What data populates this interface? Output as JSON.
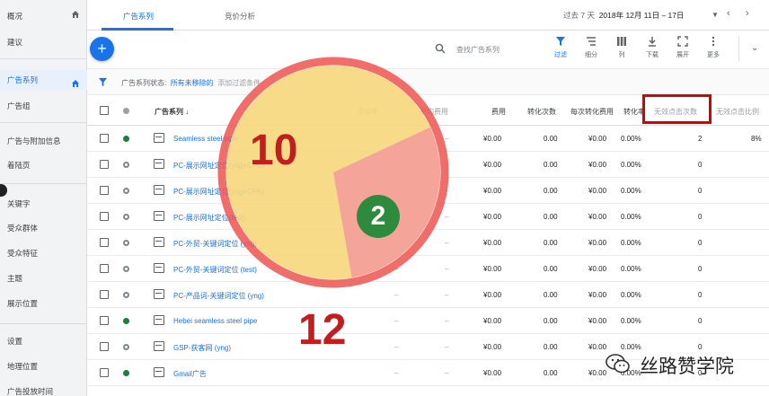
{
  "sidebar": {
    "items": [
      {
        "label": "概况",
        "active": false
      },
      {
        "label": "建议",
        "active": false
      },
      {
        "label": "广告系列",
        "active": true
      },
      {
        "label": "广告组",
        "active": false
      },
      {
        "label": "广告与附加信息",
        "active": false
      },
      {
        "label": "着陆页",
        "active": false
      },
      {
        "label": "关键字",
        "active": false
      },
      {
        "label": "受众群体",
        "active": false
      },
      {
        "label": "受众特征",
        "active": false
      },
      {
        "label": "主题",
        "active": false
      },
      {
        "label": "展示位置",
        "active": false
      },
      {
        "label": "设置",
        "active": false
      },
      {
        "label": "地理位置",
        "active": false
      },
      {
        "label": "广告投放时间",
        "active": false
      }
    ]
  },
  "header": {
    "tabs": [
      "广告系列",
      "竞价分析"
    ],
    "date_prefix": "过去 7 天",
    "date_value": "2018年 12月 11日 – 17日"
  },
  "toolbar": {
    "search_placeholder": "查找广告系列",
    "tools": [
      "过滤",
      "细分",
      "列",
      "下载",
      "展开",
      "更多"
    ]
  },
  "filter": {
    "prefix": "广告系列状态:",
    "value": "所有未移除的",
    "add": "添加过滤条件"
  },
  "table": {
    "headers": [
      "广告系列",
      "互动率",
      "平均费用",
      "费用",
      "转化次数",
      "每次转化费用",
      "转化率",
      "无效点击次数",
      "无效点击比例"
    ],
    "rows": [
      {
        "name": "Seamless steel pipe",
        "status": "green",
        "cost": "¥0.00",
        "conv": "0.00",
        "cpc": "¥0.00",
        "rate": "0.00%",
        "invalid": "2",
        "invalid_rate": "8%"
      },
      {
        "name": "PC-展示网址定位(yng+CPC)",
        "status": "grey",
        "cost": "¥0.00",
        "conv": "0.00",
        "cpc": "¥0.00",
        "rate": "0.00%",
        "invalid": "0",
        "invalid_rate": ""
      },
      {
        "name": "PC-展示网址定位(yng+CPA)",
        "status": "grey",
        "cost": "¥0.00",
        "conv": "0.00",
        "cpc": "¥0.00",
        "rate": "0.00%",
        "invalid": "0",
        "invalid_rate": ""
      },
      {
        "name": "PC-展示网址定位(test)",
        "status": "grey",
        "cost": "¥0.00",
        "conv": "0.00",
        "cpc": "¥0.00",
        "rate": "0.00%",
        "invalid": "0",
        "invalid_rate": ""
      },
      {
        "name": "PC-外贸-关键词定位 (yng)",
        "status": "grey",
        "cost": "¥0.00",
        "conv": "0.00",
        "cpc": "¥0.00",
        "rate": "0.00%",
        "invalid": "0",
        "invalid_rate": ""
      },
      {
        "name": "PC-外贸-关键词定位 (test)",
        "status": "grey",
        "cost": "¥0.00",
        "conv": "0.00",
        "cpc": "¥0.00",
        "rate": "0.00%",
        "invalid": "0",
        "invalid_rate": ""
      },
      {
        "name": "PC-产品词-关键词定位 (yng)",
        "status": "grey",
        "cost": "¥0.00",
        "conv": "0.00",
        "cpc": "¥0.00",
        "rate": "0.00%",
        "invalid": "0",
        "invalid_rate": ""
      },
      {
        "name": "Hebei seamless steel pipe",
        "status": "green",
        "cost": "¥0.00",
        "conv": "0.00",
        "cpc": "¥0.00",
        "rate": "0.00%",
        "invalid": "0",
        "invalid_rate": ""
      },
      {
        "name": "GSP-获客网 (yng)",
        "status": "grey",
        "cost": "¥0.00",
        "conv": "0.00",
        "cpc": "¥0.00",
        "rate": "0.00%",
        "invalid": "0",
        "invalid_rate": ""
      },
      {
        "name": "Gmail广告",
        "status": "green",
        "cost": "¥0.00",
        "conv": "0.00",
        "cpc": "¥0.00",
        "rate": "0.00%",
        "invalid": "0",
        "invalid_rate": ""
      }
    ]
  },
  "overlay": {
    "large_number": "10",
    "small_number": "2",
    "bottom_number": "12",
    "pie_color": "#f6d77c",
    "slice_color": "#f4a09a",
    "ring_color": "#ef5350"
  },
  "watermark": {
    "text": "丝路赞学院"
  }
}
